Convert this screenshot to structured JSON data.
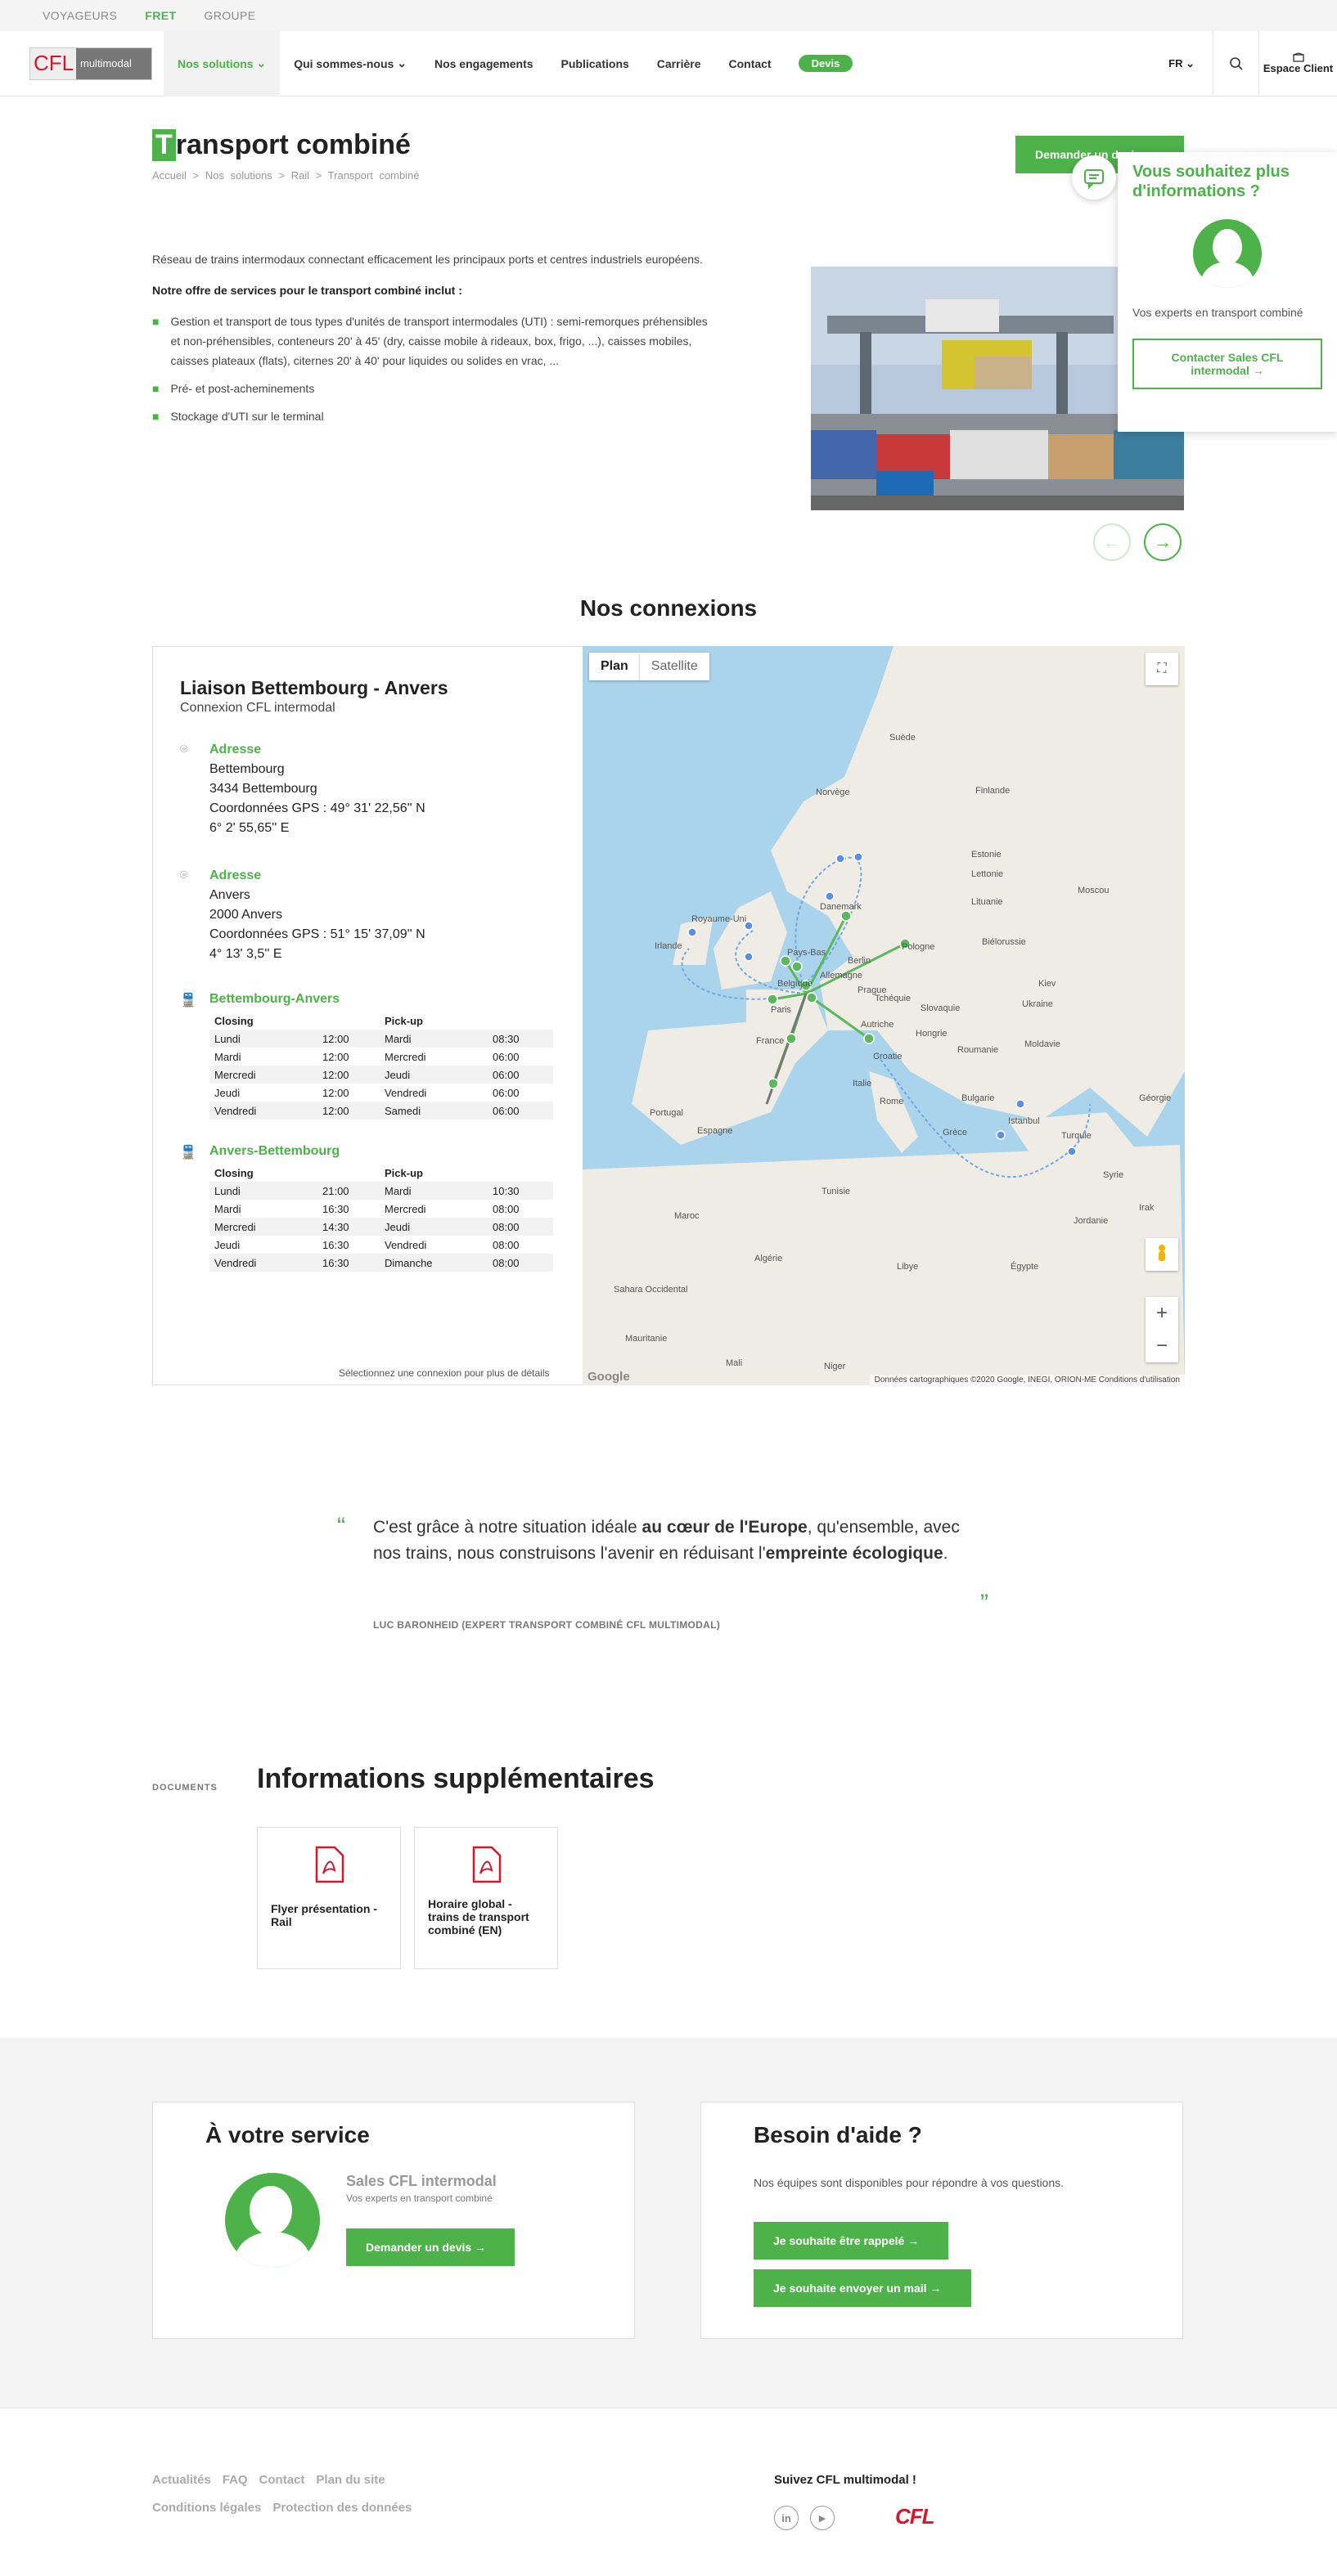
{
  "topbar": {
    "voyageurs": "VOYAGEURS",
    "fret": "FRET",
    "groupe": "GROUPE"
  },
  "nav": {
    "logo_a": "CFL",
    "logo_b": "multimodal",
    "items": [
      "Nos solutions",
      "Qui sommes-nous",
      "Nos engagements",
      "Publications",
      "Carrière",
      "Contact"
    ],
    "devis": "Devis",
    "lang": "FR",
    "espace": "Espace Client"
  },
  "page": {
    "title_first": "T",
    "title_rest": "ransport combiné",
    "breadcrumb": [
      "Accueil",
      ">",
      "Nos solutions",
      ">",
      "Rail",
      ">",
      "Transport combiné"
    ],
    "cta": "Demander un devis"
  },
  "popup": {
    "title": "Vous souhaitez plus d'informations ?",
    "sub": "Vos experts en transport combiné",
    "btn": "Contacter Sales CFL intermodal →"
  },
  "intro": {
    "p1": "Réseau de trains intermodaux connectant efficacement les principaux ports et centres industriels européens.",
    "p2": "Notre offre de services pour le transport combiné inclut :",
    "bullets": [
      "Gestion et transport de tous types d'unités de transport intermodales (UTI) : semi-remorques préhensibles et non-préhensibles, conteneurs 20' à 45' (dry, caisse mobile à rideaux, box, frigo, ...), caisses mobiles, caisses plateaux (flats), citernes 20' à 40' pour liquides ou solides en vrac, ...",
      "Pré- et post-acheminements",
      "Stockage d'UTI sur le terminal"
    ]
  },
  "connexions": {
    "title": "Nos connexions",
    "liaison": "Liaison Bettembourg - Anvers",
    "sub": "Connexion CFL intermodal",
    "adr_label": "Adresse",
    "a1": [
      "Bettembourg",
      "3434 Bettembourg",
      "Coordonnées GPS : 49° 31' 22,56'' N",
      "6° 2' 55,65'' E"
    ],
    "a2": [
      "Anvers",
      "2000 Anvers",
      "Coordonnées GPS : 51° 15' 37,09'' N",
      "4° 13' 3,5'' E"
    ],
    "s1": "Bettembourg-Anvers",
    "s2": "Anvers-Bettembourg",
    "closing": "Closing",
    "pickup": "Pick-up",
    "t1": [
      [
        "Lundi",
        "12:00",
        "Mardi",
        "08:30"
      ],
      [
        "Mardi",
        "12:00",
        "Mercredi",
        "06:00"
      ],
      [
        "Mercredi",
        "12:00",
        "Jeudi",
        "06:00"
      ],
      [
        "Jeudi",
        "12:00",
        "Vendredi",
        "06:00"
      ],
      [
        "Vendredi",
        "12:00",
        "Samedi",
        "06:00"
      ]
    ],
    "t2": [
      [
        "Lundi",
        "21:00",
        "Mardi",
        "10:30"
      ],
      [
        "Mardi",
        "16:30",
        "Mercredi",
        "08:00"
      ],
      [
        "Mercredi",
        "14:30",
        "Jeudi",
        "08:00"
      ],
      [
        "Jeudi",
        "16:30",
        "Vendredi",
        "08:00"
      ],
      [
        "Vendredi",
        "16:30",
        "Dimanche",
        "08:00"
      ]
    ],
    "hint": "Sélectionnez une connexion pour plus de détails"
  },
  "map": {
    "plan": "Plan",
    "sat": "Satellite",
    "credits": "Données cartographiques ©2020 Google, INEGI, ORION-ME   Conditions d'utilisation",
    "google": "Google",
    "labels": [
      "Suède",
      "Finlande",
      "Norvège",
      "Estonie",
      "Lettonie",
      "Lituanie",
      "Danemark",
      "Royaume-Uni",
      "Irlande",
      "Pays-Bas",
      "Berlin",
      "Allemagne",
      "Pologne",
      "Biélorussie",
      "Moscou",
      "Belgique",
      "Tchéquie",
      "Slovaquie",
      "Ukraine",
      "France",
      "Autriche",
      "Hongrie",
      "Roumanie",
      "Italie",
      "Bulgarie",
      "Portugal",
      "Espagne",
      "Grèce",
      "Turquie",
      "Géorgie",
      "Maroc",
      "Algérie",
      "Tunisie",
      "Libye",
      "Égypte",
      "Irak",
      "Syrie",
      "Jordanie",
      "Mauritanie",
      "Mali",
      "Niger",
      "Sahara Occidental",
      "Kiev",
      "Moldavie",
      "Croatie",
      "Prague",
      "Paris",
      "Rome",
      "Istanbul"
    ]
  },
  "quote": {
    "t1": "C'est grâce à notre situation idéale ",
    "b1": "au cœur de l'Europe",
    "t2": ", qu'ensemble, avec nos trains, nous construisons l'avenir en réduisant l'",
    "b2": "empreinte écologique",
    "t3": ".",
    "author": "LUC BARONHEID (EXPERT TRANSPORT COMBINÉ CFL MULTIMODAL)"
  },
  "docs": {
    "label": "DOCUMENTS",
    "title": "Informations supplémentaires",
    "items": [
      "Flyer présentation - Rail",
      "Horaire global - trains de transport combiné (EN)"
    ]
  },
  "service": {
    "title": "À votre service",
    "name": "Sales CFL intermodal",
    "sub": "Vos experts en transport combiné",
    "btn": "Demander un devis →"
  },
  "aide": {
    "title": "Besoin d'aide ?",
    "text": "Nos équipes sont disponibles pour répondre à vos questions.",
    "b1": "Je souhaite être rappelé →",
    "b2": "Je souhaite envoyer un mail →"
  },
  "footer": {
    "links1": [
      "Actualités",
      "FAQ",
      "Contact",
      "Plan du site"
    ],
    "links2": [
      "Conditions légales",
      "Protection des données"
    ],
    "follow": "Suivez CFL multimodal !",
    "in": "in",
    "yt": "▶",
    "cfl": "CFL"
  }
}
